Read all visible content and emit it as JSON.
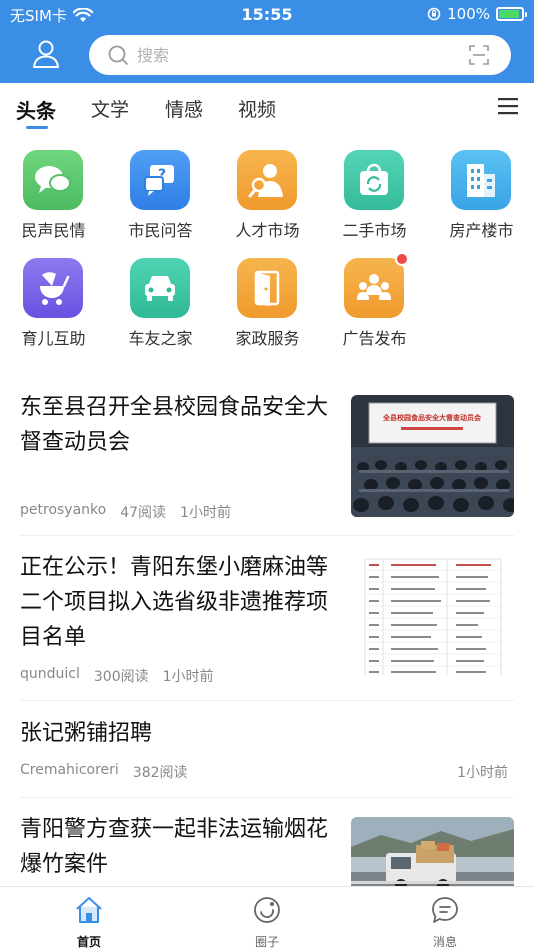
{
  "status_bar": {
    "carrier": "无SIM卡",
    "time": "15:55",
    "battery": "100%",
    "battery_level": 1.0
  },
  "search": {
    "placeholder": "搜索"
  },
  "tabs": [
    {
      "label": "头条",
      "active": true
    },
    {
      "label": "文学",
      "active": false
    },
    {
      "label": "情感",
      "active": false
    },
    {
      "label": "视频",
      "active": false
    }
  ],
  "services": [
    {
      "label": "民声民情",
      "icon": "chat-bubbles-icon",
      "color": "#5cc96f"
    },
    {
      "label": "市民问答",
      "icon": "question-icon",
      "color": "#3b8ff0"
    },
    {
      "label": "人才市场",
      "icon": "talent-search-icon",
      "color": "#f3a53a"
    },
    {
      "label": "二手市场",
      "icon": "recycle-bag-icon",
      "color": "#43c6a8"
    },
    {
      "label": "房产楼市",
      "icon": "buildings-icon",
      "color": "#49b1ec"
    },
    {
      "label": "育儿互助",
      "icon": "stroller-icon",
      "color": "#7b64e8"
    },
    {
      "label": "车友之家",
      "icon": "car-icon",
      "color": "#3cc6a2"
    },
    {
      "label": "家政服务",
      "icon": "door-icon",
      "color": "#f1a53a"
    },
    {
      "label": "广告发布",
      "icon": "group-icon",
      "color": "#f3a53a",
      "badge": true
    }
  ],
  "news": [
    {
      "title": "东至县召开全县校园食品安全大督查动员会",
      "author": "petrosyanko",
      "reads": "47阅读",
      "time": "1小时前",
      "has_image": true,
      "banner": "全县校园食品安全大督查动员会"
    },
    {
      "title": "正在公示！青阳东堡小磨麻油等二个项目拟入选省级非遗推荐项目名单",
      "author": "qunduicl",
      "reads": "300阅读",
      "time": "1小时前",
      "has_image": true
    },
    {
      "title": "张记粥铺招聘",
      "author": "Cremahicoreri",
      "reads": "382阅读",
      "time": "1小时前",
      "has_image": false
    },
    {
      "title": "青阳警方查获一起非法运输烟花爆竹案件",
      "author": "",
      "reads": "",
      "time": "",
      "has_image": true
    }
  ],
  "bottom_nav": [
    {
      "label": "首页",
      "icon": "home-icon",
      "active": true
    },
    {
      "label": "圈子",
      "icon": "circle-icon",
      "active": false
    },
    {
      "label": "消息",
      "icon": "message-icon",
      "active": false
    }
  ],
  "colors": {
    "brand": "#3a8ee6",
    "badge": "#ef4a4a"
  }
}
